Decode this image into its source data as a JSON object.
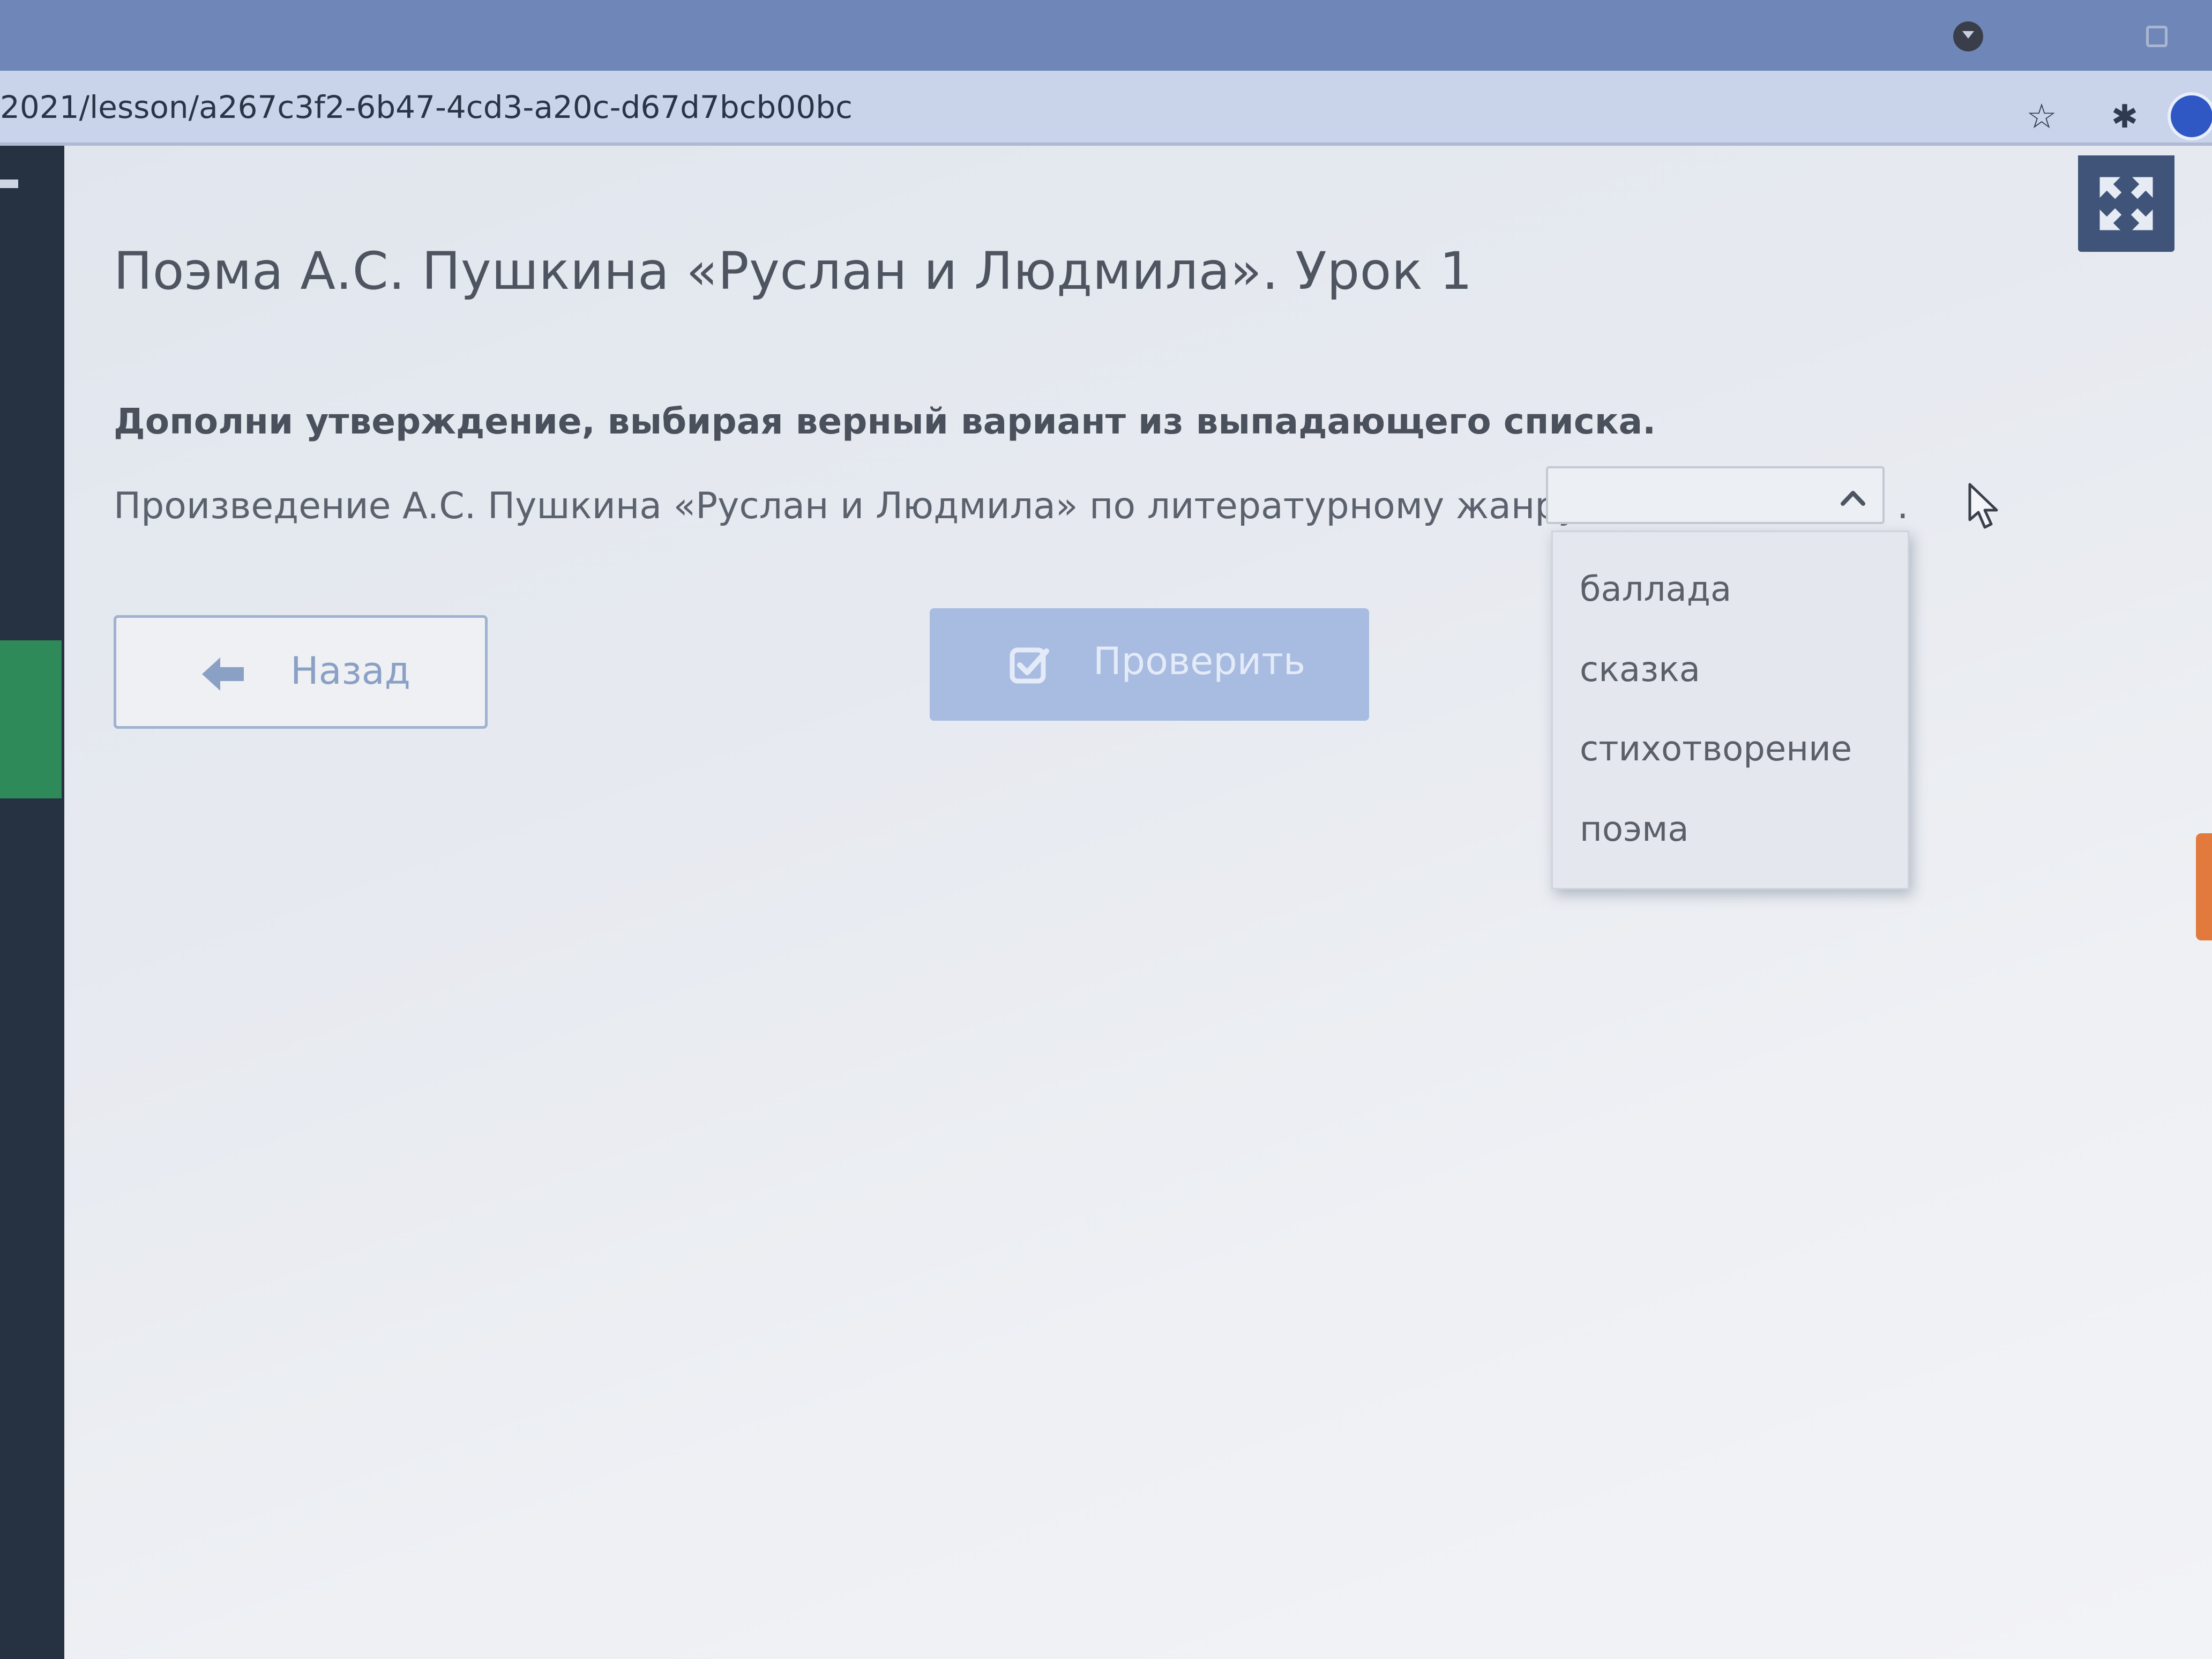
{
  "browser": {
    "url": "2021/lesson/a267c3f2-6b47-4cd3-a20c-d67d7bcb00bc"
  },
  "lesson": {
    "title": "Поэма А.С. Пушкина «Руслан и Людмила». Урок 1",
    "instruction": "Дополни утверждение, выбирая верный вариант из выпадающего списка.",
    "statement": "Произведение А.С. Пушкина «Руслан и Людмила» по литературному жанру –",
    "trailing": ".",
    "dropdown": {
      "selected": "",
      "options": [
        "баллада",
        "сказка",
        "стихотворение",
        "поэма"
      ]
    }
  },
  "buttons": {
    "back_label": "Назад",
    "check_label": "Проверить"
  },
  "colors": {
    "accent": "#a8bbe0",
    "back_border": "#9fb2cf",
    "fullscreen_bg": "#3f5478",
    "side_green": "#2e8a58"
  }
}
